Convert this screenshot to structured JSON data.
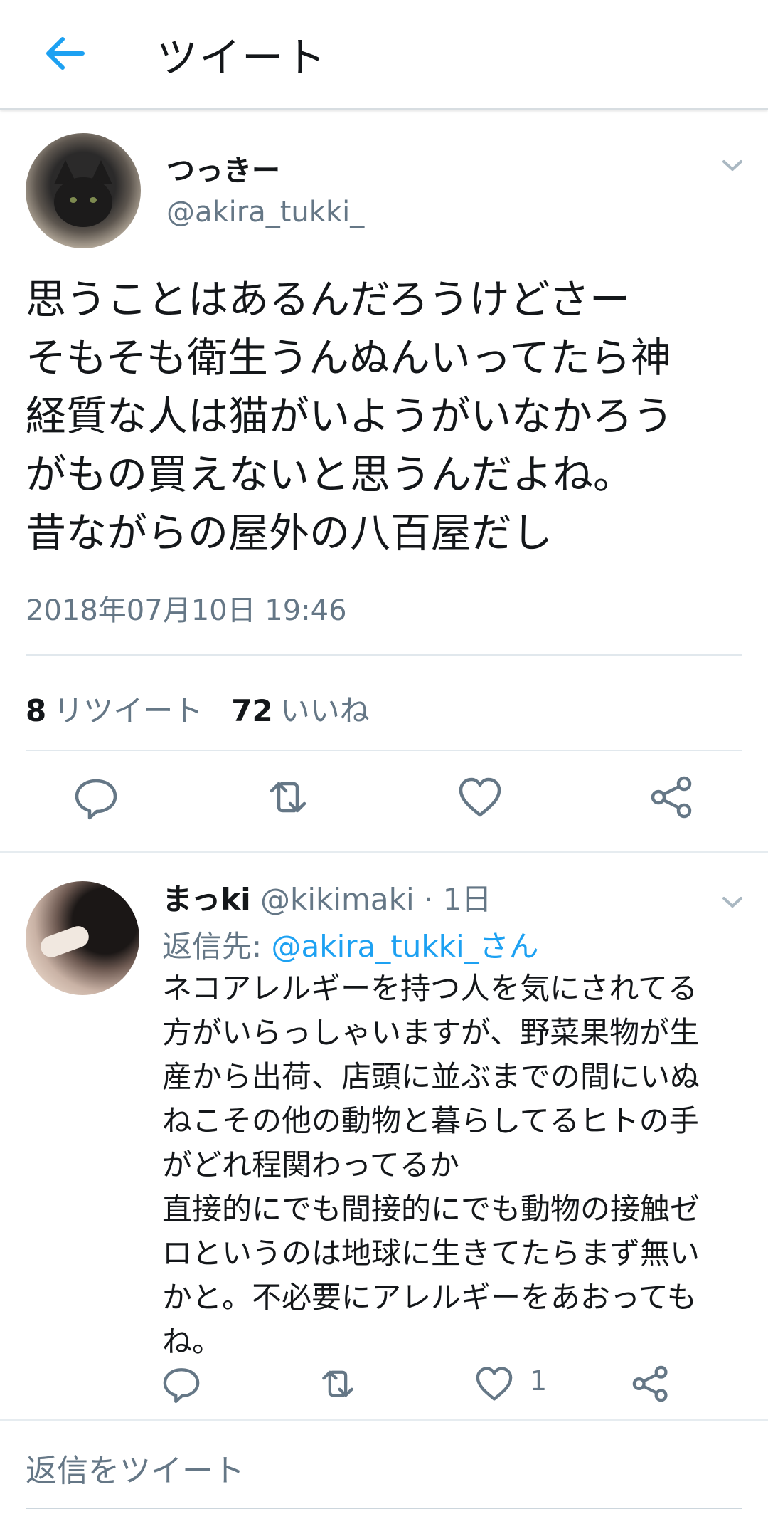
{
  "appbar": {
    "title": "ツイート",
    "back_icon": "arrow-left-icon"
  },
  "tweet": {
    "display_name": "つっきー",
    "handle": "@akira_tukki_",
    "text": "思うことはあるんだろうけどさー\nそもそも衛生うんぬんいってたら神\n経質な人は猫がいようがいなかろう\nがもの買えないと思うんだよね。\n昔ながらの屋外の八百屋だし",
    "timestamp": "2018年07月10日 19:46",
    "retweet_count": "8",
    "retweet_label": "リツイート",
    "like_count": "72",
    "like_label": "いいね",
    "actions": [
      "reply-icon",
      "retweet-icon",
      "heart-icon",
      "share-icon"
    ]
  },
  "reply": {
    "display_name": "まっki",
    "handle": "@kikimaki",
    "separator": " · ",
    "age": "1日",
    "reply_to_prefix": "返信先: ",
    "reply_to_link": "@akira_tukki_さん",
    "text": "ネコアレルギーを持つ人を気にされてる\n方がいらっしゃいますが、野菜果物が生\n産から出荷、店頭に並ぶまでの間にいぬ\nねこその他の動物と暮らしてるヒトの手\nがどれ程関わってるか\n直接的にでも間接的にでも動物の接触ゼ\nロというのは地球に生きてたらまず無い\nかと。不必要にアレルギーをあおっても\nね。",
    "like_count": "1"
  },
  "compose": {
    "placeholder": "返信をツイート"
  },
  "colors": {
    "accent": "#1da1f2",
    "secondary_text": "#657786",
    "icon": "#657786"
  }
}
